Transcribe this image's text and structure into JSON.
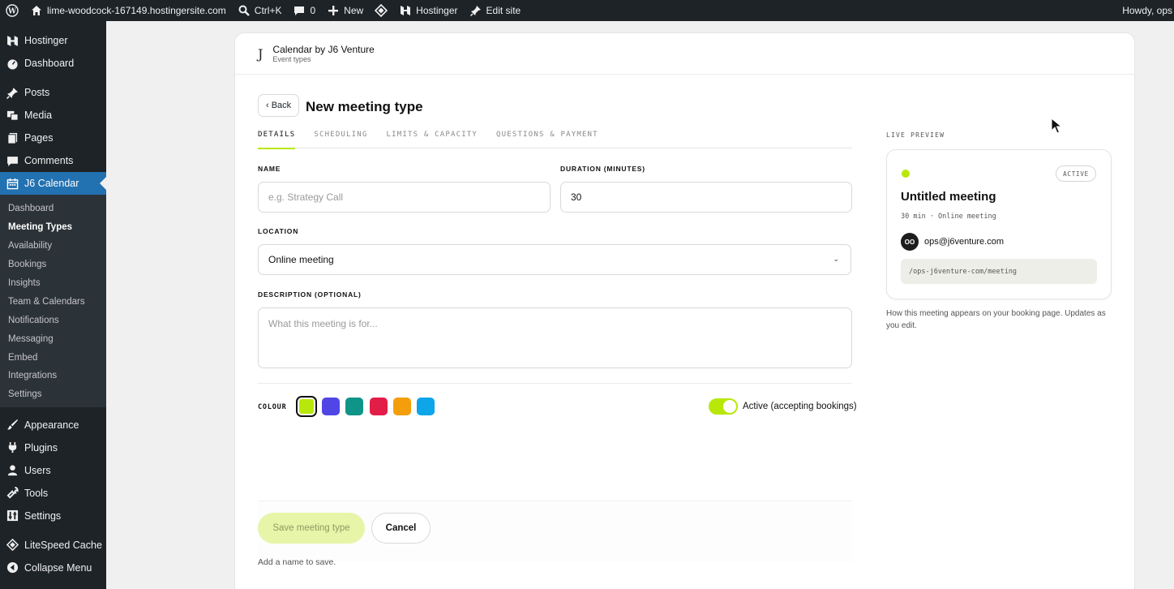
{
  "adminbar": {
    "site": "lime-woodcock-167149.hostingersite.com",
    "search_shortcut": "Ctrl+K",
    "comments_count": "0",
    "new_label": "New",
    "hostinger_label": "Hostinger",
    "edit_site_label": "Edit site",
    "howdy": "Howdy, ops"
  },
  "sidebar": {
    "top_items": [
      "Hostinger",
      "Dashboard",
      "Posts",
      "Media",
      "Pages",
      "Comments"
    ],
    "current_item": "J6 Calendar",
    "submenu": [
      "Dashboard",
      "Meeting Types",
      "Availability",
      "Bookings",
      "Insights",
      "Team & Calendars",
      "Notifications",
      "Messaging",
      "Embed",
      "Integrations",
      "Settings"
    ],
    "bottom_items": [
      "Appearance",
      "Plugins",
      "Users",
      "Tools",
      "Settings",
      "LiteSpeed Cache",
      "Collapse Menu"
    ]
  },
  "header": {
    "logo": "J",
    "title": "Calendar by J6 Venture",
    "subtitle": "Event types"
  },
  "page": {
    "back_label": "‹ Back",
    "title": "New meeting type"
  },
  "tabs": [
    "DETAILS",
    "SCHEDULING",
    "LIMITS & CAPACITY",
    "QUESTIONS & PAYMENT"
  ],
  "form": {
    "name_label": "NAME",
    "name_placeholder": "e.g. Strategy Call",
    "duration_label": "DURATION (MINUTES)",
    "duration_value": "30",
    "location_label": "LOCATION",
    "location_value": "Online meeting",
    "description_label": "DESCRIPTION (OPTIONAL)",
    "description_placeholder": "What this meeting is for...",
    "colour_label": "COLOUR",
    "colours": [
      "#b8e80a",
      "#5046e5",
      "#0f9488",
      "#e11d48",
      "#f59e0b",
      "#0ea5e9"
    ],
    "active_label": "Active (accepting bookings)",
    "active": true
  },
  "actions": {
    "save_label": "Save meeting type",
    "cancel_label": "Cancel",
    "hint": "Add a name to save."
  },
  "preview": {
    "label": "LIVE PREVIEW",
    "badge": "ACTIVE",
    "title": "Untitled meeting",
    "meta": "30 min · Online meeting",
    "avatar": "OO",
    "email": "ops@j6venture.com",
    "url": "/ops-j6venture-com/meeting",
    "caption": "How this meeting appears on your booking page. Updates as you edit."
  }
}
